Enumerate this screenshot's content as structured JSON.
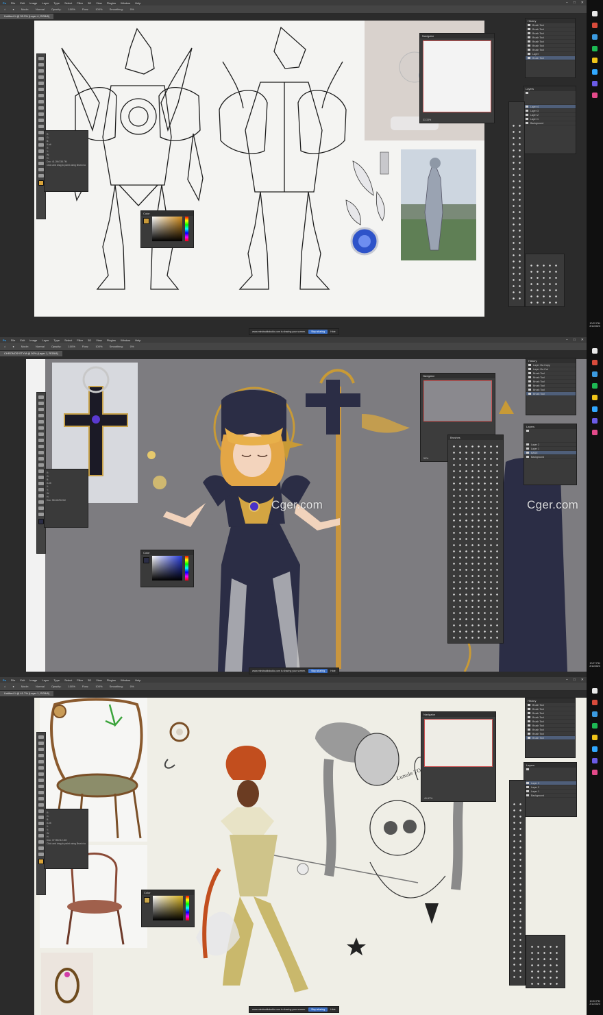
{
  "menu": [
    "File",
    "Edit",
    "Image",
    "Layer",
    "Type",
    "Select",
    "Filter",
    "3D",
    "View",
    "Plugins",
    "Window",
    "Help"
  ],
  "options_bar": {
    "mode_label": "Mode:",
    "mode_value": "Normal",
    "opacity_label": "Opacity:",
    "opacity_value": "100%",
    "flow_label": "Flow:",
    "flow_value": "100%",
    "smoothing_label": "Smoothing:",
    "smoothing_value": "0%"
  },
  "frames": [
    {
      "doc_tab": "Untitled-1 @ 33.3% (Layer 4, RGB/8)",
      "history_title": "History",
      "history_items": [
        "Brush Tool",
        "Brush Tool",
        "Brush Tool",
        "Brush Tool",
        "Brush Tool",
        "Brush Tool",
        "Brush Tool",
        "Layer",
        "Brush Tool"
      ],
      "layers_title": "Layers",
      "layers": [
        "Layer 4",
        "Layer 3",
        "Layer 2",
        "Layer 1",
        "Background"
      ],
      "navigator_title": "Navigator",
      "nav_zoom": "33.33%",
      "info_lines": [
        "R:",
        "G:",
        "B:",
        "8-bit",
        "X:",
        "Y:",
        "W:",
        "H:",
        "Doc: 41.2M/138.7M",
        "Click and drag to paint using Brush tool."
      ],
      "color_title": "Color",
      "share_text": "www.mindwalkstudio.com is sharing your screen.",
      "share_stop": "Stop sharing",
      "share_hide": "Hide",
      "clock": [
        "10:22 PM",
        "2/11/2023"
      ]
    },
    {
      "doc_tab": "CHRONOS*STYM @ 50% (Layer 1, RGB/8)",
      "history_title": "History",
      "history_items": [
        "Layer Via Copy",
        "Layer Via Cut",
        "Brush Tool",
        "Brush Tool",
        "Brush Tool",
        "Brush Tool",
        "Brush Tool",
        "Brush Tool"
      ],
      "layers_title": "Layers",
      "layers": [
        "Layer 2",
        "Layer 1",
        "BASE",
        "Background"
      ],
      "navigator_title": "Navigator",
      "nav_zoom": "50%",
      "brushes_title": "Brushes",
      "info_lines": [
        "R:",
        "G:",
        "B:",
        "8-bit",
        "X:",
        "Y:",
        "W:",
        "H:",
        "Doc: 58.4M/96.5M"
      ],
      "color_title": "Color",
      "watermark_left": "Cger.com",
      "watermark_right": "Cger.com",
      "share_text": "www.mindwalkstudio.com is sharing your screen.",
      "share_stop": "Stop sharing",
      "share_hide": "Hide",
      "clock": [
        "10:27 PM",
        "2/11/2023"
      ]
    },
    {
      "doc_tab": "Untitled-1 @ 41.7% (Layer 1, RGB/8)",
      "history_title": "History",
      "history_items": [
        "Brush Tool",
        "Brush Tool",
        "Brush Tool",
        "Brush Tool",
        "Brush Tool",
        "Brush Tool",
        "Brush Tool",
        "Brush Tool",
        "Brush Tool"
      ],
      "layers_title": "Layers",
      "layers": [
        "Layer 3",
        "Layer 2",
        "Layer 1",
        "Background"
      ],
      "navigator_title": "Navigator",
      "nav_zoom": "41.67%",
      "info_lines": [
        "R:",
        "G:",
        "B:",
        "8-bit",
        "X:",
        "Y:",
        "W:",
        "H:",
        "Doc: 37.9M/112.4M",
        "Click and drag to paint using Brush tool."
      ],
      "color_title": "Color",
      "sketch_note": "Lunule TO",
      "share_text": "www.mindwalkstudio.com is sharing your screen.",
      "share_stop": "Stop sharing",
      "share_hide": "Hide",
      "clock": [
        "10:33 PM",
        "2/11/2023"
      ]
    }
  ],
  "colors": {
    "ps_dark": "#2b2b2b",
    "ps_panel": "#3a3a3a",
    "canvas_white": "#f4f4f2",
    "canvas_grey": "#7d7c80",
    "canvas_cream": "#efeee6",
    "gold": "#d4a542",
    "navy": "#2b2d45",
    "accent_blue": "#3b6fc4"
  }
}
